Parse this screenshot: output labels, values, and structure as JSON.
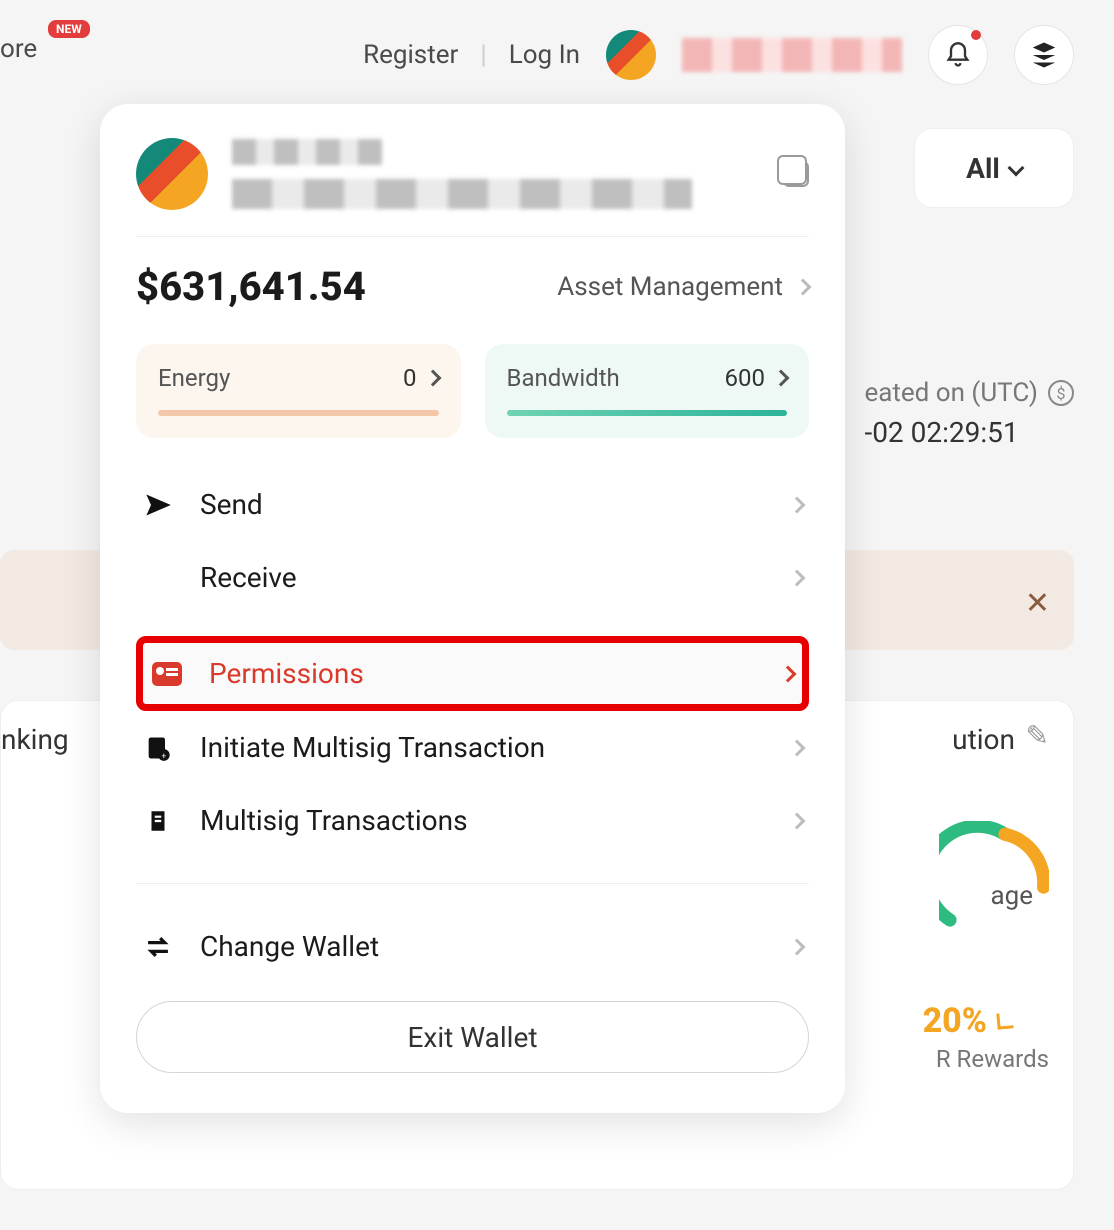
{
  "header": {
    "more_label": "ore",
    "new_badge": "NEW",
    "register_label": "Register",
    "login_label": "Log In"
  },
  "filter": {
    "all_label": "All"
  },
  "background": {
    "created_label": "eated on (UTC)",
    "created_value": "-02 02:29:51",
    "left_text": "nking",
    "right_text_suffix": "ution",
    "age_text": "age",
    "pct_text": "20%",
    "rewards_text": "R Rewards"
  },
  "panel": {
    "balance": "$631,641.54",
    "asset_mgmt_label": "Asset Management",
    "energy": {
      "label": "Energy",
      "value": "0"
    },
    "bandwidth": {
      "label": "Bandwidth",
      "value": "600"
    },
    "menu": {
      "send": "Send",
      "receive": "Receive",
      "permissions": "Permissions",
      "initiate_multisig": "Initiate Multisig Transaction",
      "multisig_tx": "Multisig Transactions",
      "change_wallet": "Change Wallet"
    },
    "exit_label": "Exit Wallet"
  }
}
